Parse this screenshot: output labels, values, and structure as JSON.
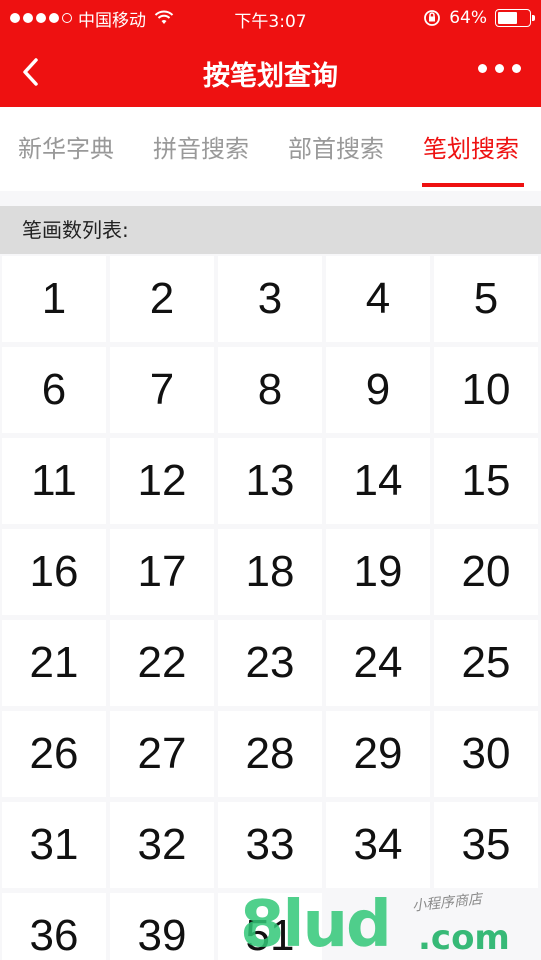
{
  "status_bar": {
    "carrier": "中国移动",
    "time": "下午3:07",
    "battery": "64%",
    "battery_level": 0.64
  },
  "nav": {
    "title": "按笔划查询",
    "back_icon": "chevron-left-icon",
    "more_icon": "more-dots-icon"
  },
  "tabs": [
    {
      "label": "新华字典",
      "active": false
    },
    {
      "label": "拼音搜索",
      "active": false
    },
    {
      "label": "部首搜索",
      "active": false
    },
    {
      "label": "笔划搜索",
      "active": true
    }
  ],
  "section": {
    "title": "笔画数列表:"
  },
  "strokes": [
    "1",
    "2",
    "3",
    "4",
    "5",
    "6",
    "7",
    "8",
    "9",
    "10",
    "11",
    "12",
    "13",
    "14",
    "15",
    "16",
    "17",
    "18",
    "19",
    "20",
    "21",
    "22",
    "23",
    "24",
    "25",
    "26",
    "27",
    "28",
    "29",
    "30",
    "31",
    "32",
    "33",
    "34",
    "35",
    "36",
    "39",
    "51"
  ],
  "watermark": {
    "logo": "8lud",
    "suffix": ".com",
    "tagline": "小程序商店"
  },
  "colors": {
    "accent": "#ee1111",
    "tab_inactive": "#999999",
    "section_bg": "#dcdcdc"
  }
}
